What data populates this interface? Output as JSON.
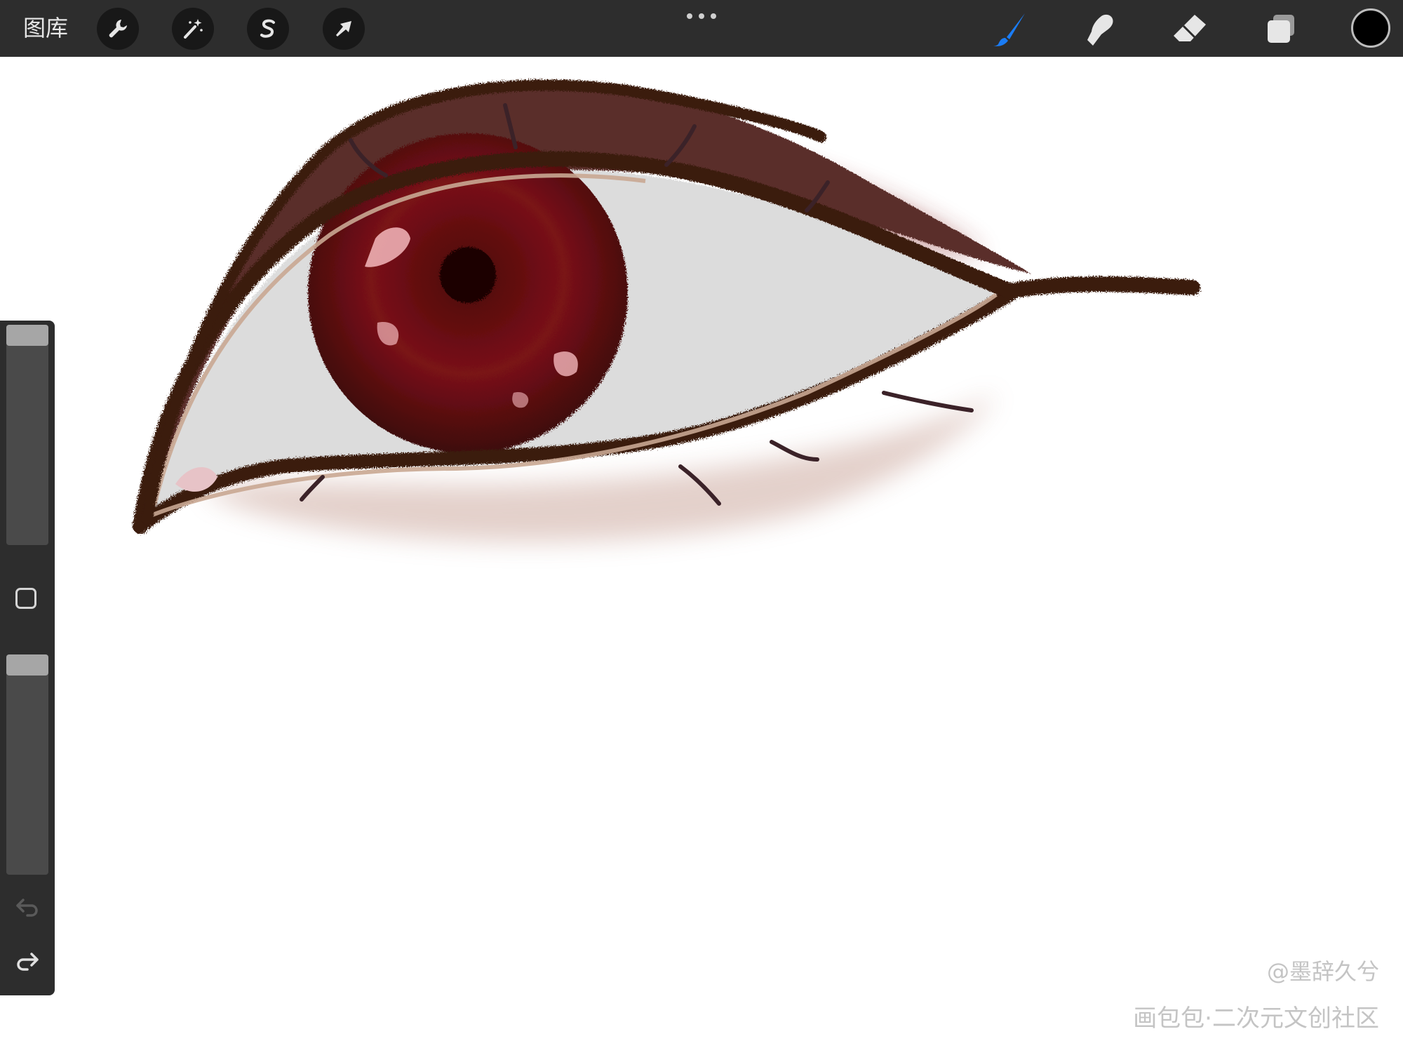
{
  "toolbar": {
    "gallery_label": "图库",
    "left_tools": [
      {
        "name": "actions",
        "icon": "wrench-icon"
      },
      {
        "name": "adjustments",
        "icon": "magic-wand-icon"
      },
      {
        "name": "selection",
        "icon": "selection-s-icon"
      },
      {
        "name": "transform",
        "icon": "arrow-cursor-icon"
      }
    ],
    "more_menu_icon": "ellipsis-icon",
    "right_tools": [
      {
        "name": "brush",
        "icon": "brush-icon",
        "active": true,
        "color": "#1a7cf5"
      },
      {
        "name": "smudge",
        "icon": "smudge-finger-icon",
        "active": false
      },
      {
        "name": "eraser",
        "icon": "eraser-icon",
        "active": false
      },
      {
        "name": "layers",
        "icon": "layers-icon",
        "active": false
      }
    ],
    "current_color": "#000000"
  },
  "sidebar": {
    "brush_size_level": 0.0,
    "opacity_level": 0.0,
    "modifier_icon": "square-modifier-icon",
    "undo_icon": "undo-icon",
    "redo_icon": "redo-icon",
    "undo_enabled": false
  },
  "canvas": {
    "artwork": "eye-drawing",
    "colors": {
      "background": "#ffffff",
      "iris": "#6b0f12",
      "eyelid": "#5a2e2a",
      "outline": "#3a1a10",
      "sclera": "#dcdcdc"
    }
  },
  "watermark": {
    "author": "@墨辞久兮",
    "site": "画包包·二次元文创社区"
  }
}
